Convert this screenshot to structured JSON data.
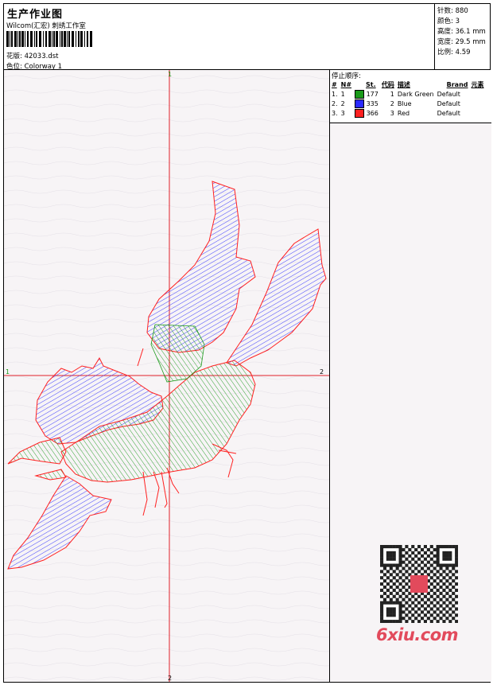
{
  "header": {
    "title": "生产作业图",
    "company": "Wilcom(汇宏) 刺绣工作室",
    "design_label": "花版:",
    "design_value": "42033.dst",
    "colorway_label": "色位:",
    "colorway_value": "Colorway 1"
  },
  "stats": [
    {
      "label": "针数:",
      "value": "880"
    },
    {
      "label": "颜色:",
      "value": "3"
    },
    {
      "label": "高度:",
      "value": "36.1 mm"
    },
    {
      "label": "宽度:",
      "value": "29.5 mm"
    },
    {
      "label": "比例:",
      "value": "4.59"
    }
  ],
  "stop_sequence": {
    "title": "停止顺序:",
    "columns": [
      "#",
      "N#",
      "St.",
      "代码",
      "描述",
      "Brand",
      "元素"
    ],
    "rows": [
      {
        "num": "1.",
        "n": "1",
        "color": "#1a9a1a",
        "stitches": "177",
        "code": "1",
        "desc": "Dark Green",
        "brand": "Default"
      },
      {
        "num": "2.",
        "n": "2",
        "color": "#2a2aff",
        "stitches": "335",
        "code": "2",
        "desc": "Blue",
        "brand": "Default"
      },
      {
        "num": "3.",
        "n": "3",
        "color": "#ff2020",
        "stitches": "366",
        "code": "3",
        "desc": "Red",
        "brand": "Default"
      }
    ]
  },
  "axes": {
    "top": "1",
    "bottom": "2",
    "left": "1",
    "right": "2"
  },
  "watermark": {
    "text": "6xiu.com"
  }
}
